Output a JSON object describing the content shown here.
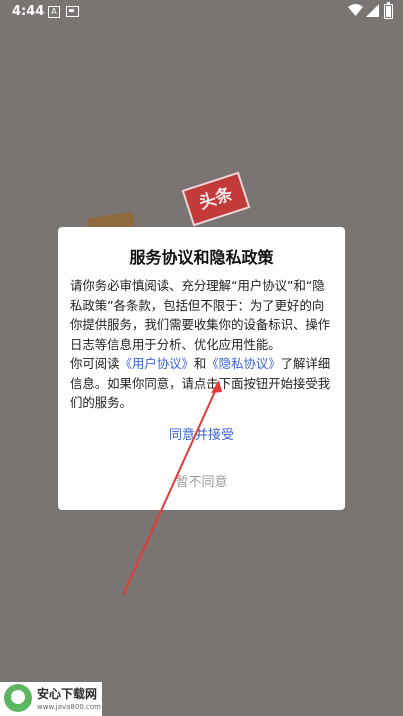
{
  "status_bar": {
    "time": "4:44",
    "wifi_icon": "wifi-icon",
    "signal_icon": "signal-icon",
    "battery_icon": "battery-icon"
  },
  "background": {
    "logo_text": "头条"
  },
  "dialog": {
    "title": "服务协议和隐私政策",
    "paragraph1": "请你务必审慎阅读、充分理解“用户协议”和“隐私政策”各条款，包括但不限于：为了更好的向你提供服务，我们需要收集你的设备标识、操作日志等信息用于分析、优化应用性能。",
    "p2_prefix": "你可阅读",
    "user_agreement_link": "《用户协议》",
    "p2_and": "和",
    "privacy_link": "《隐私协议》",
    "p2_suffix": "了解详细信息。如果你同意，请点击下面按钮开始接受我们的服务。",
    "agree_button": "同意并接受",
    "decline_button": "暂不同意"
  },
  "watermark": {
    "title": "安心下载网",
    "url": "www.java800.com"
  },
  "colors": {
    "link": "#3b62d8",
    "overlay": "#7a7573",
    "arrow": "#e53935"
  }
}
